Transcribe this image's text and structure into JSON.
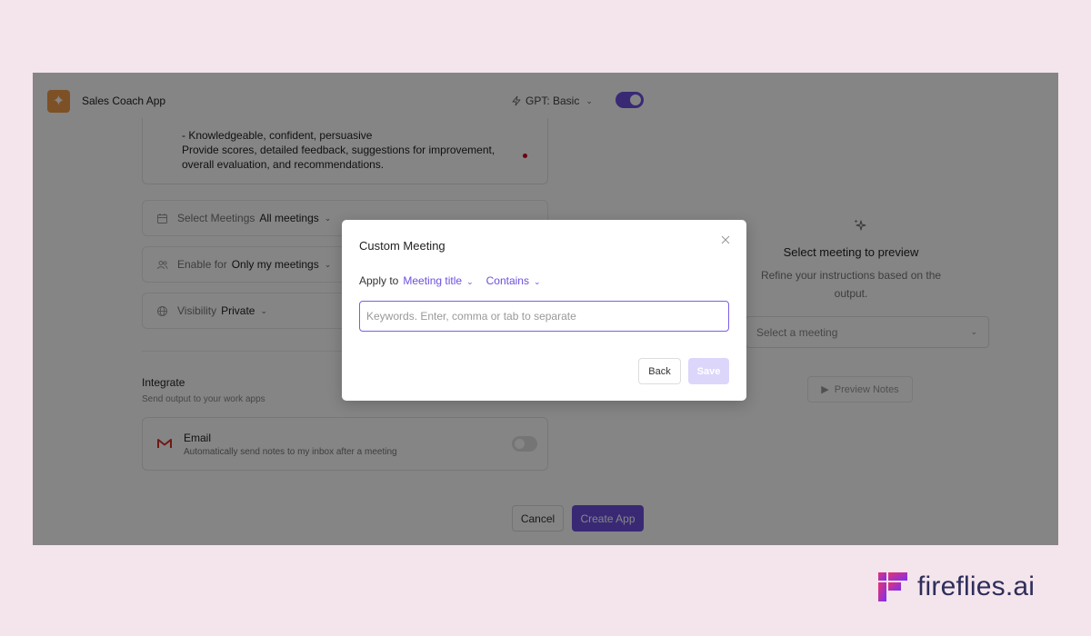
{
  "app": {
    "title": "Sales Coach App",
    "gpt_label": "GPT: Basic"
  },
  "prompt": {
    "text": "- Knowledgeable, confident, persuasive\nProvide scores, detailed feedback, suggestions for improvement, overall evaluation, and recommendations."
  },
  "settings": {
    "select_meetings": {
      "label": "Select Meetings",
      "value": "All meetings"
    },
    "enable_for": {
      "label": "Enable for",
      "value": "Only my meetings"
    },
    "visibility": {
      "label": "Visibility",
      "value": "Private"
    }
  },
  "integrate": {
    "title": "Integrate",
    "subtitle": "Send output to your work apps",
    "email": {
      "title": "Email",
      "description": "Automatically send notes to my inbox after a meeting",
      "enabled": false
    }
  },
  "footer": {
    "cancel_label": "Cancel",
    "create_label": "Create App"
  },
  "preview": {
    "title": "Select meeting to preview",
    "subtitle": "Refine your instructions based on the output.",
    "select_placeholder": "Select a meeting",
    "button_label": "Preview Notes"
  },
  "modal": {
    "title": "Custom Meeting",
    "apply_label": "Apply to",
    "field_dropdown": "Meeting title",
    "operator_dropdown": "Contains",
    "keywords_placeholder": "Keywords. Enter, comma or tab to separate",
    "keywords_value": "",
    "back_label": "Back",
    "save_label": "Save"
  },
  "brand": {
    "name": "fireflies.ai"
  },
  "colors": {
    "accent": "#6d4fe0",
    "background": "#f4e4ec",
    "app_logo": "#f29a4a",
    "brand_text": "#2d2e5a"
  },
  "icons": {
    "app_logo": "sparkle-icon",
    "gpt": "lightning-icon",
    "select_meetings": "calendar-icon",
    "enable_for": "users-icon",
    "visibility": "globe-icon",
    "email": "gmail-icon",
    "preview": "sparkles-icon",
    "close": "close-icon",
    "play": "play-icon",
    "brand": "fireflies-logo"
  }
}
